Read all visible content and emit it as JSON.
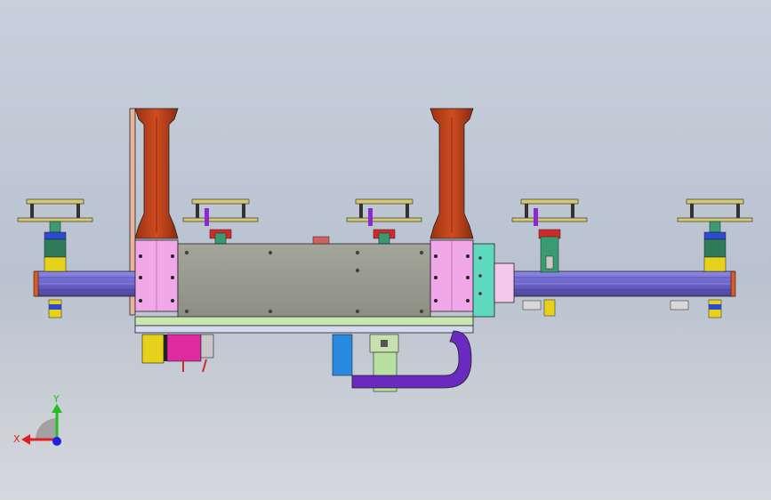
{
  "viewport": {
    "background_top": "#c9d0dd",
    "background_bottom": "#d6d8dc"
  },
  "model": {
    "colors": {
      "rail": "#6a63c9",
      "rail_dark": "#4a4499",
      "column": "#c0421a",
      "column_dark": "#7c2a10",
      "plate_pink": "#f0a8e8",
      "carriage": "#9a9c92",
      "end_block": "#5fd8c0",
      "cable_chain": "#6a2ac0",
      "bracket_green": "#3a9a70",
      "bracket_red": "#d02a2a",
      "motor_yellow": "#e6d21a",
      "motor_magenta": "#e02aa0",
      "sensor_blue": "#2a8ae0",
      "cylinder_green": "#b8e0a0",
      "stand_yellow": "#d4c870"
    },
    "icons": [
      "gripper-station-icon",
      "linear-rail-icon",
      "column-icon",
      "cable-chain-icon",
      "motor-icon"
    ]
  },
  "triad": {
    "x_label": "X",
    "y_label": "Y",
    "x_color": "#e02020",
    "y_color": "#20c020",
    "z_color": "#2020e0"
  }
}
